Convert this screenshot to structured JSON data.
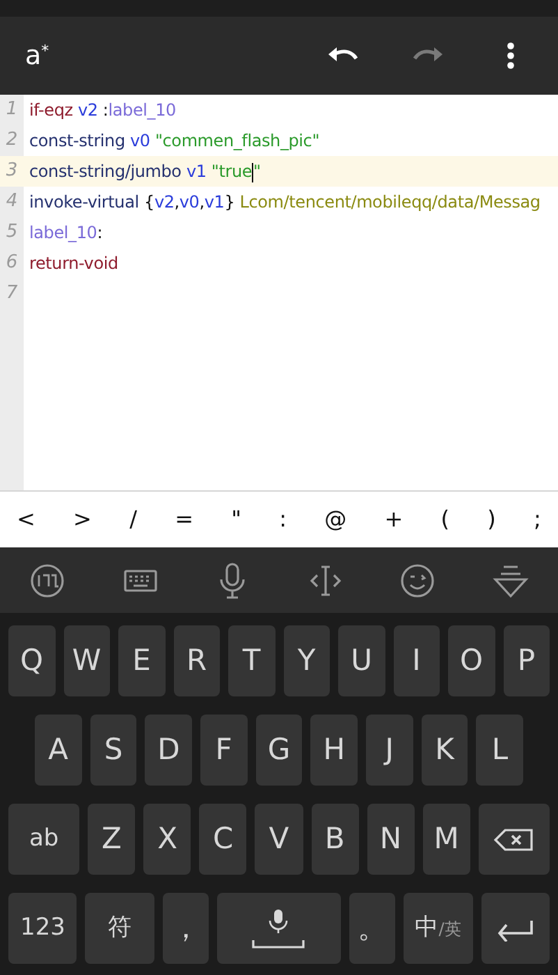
{
  "app_bar": {
    "title": "a$^{*}$",
    "actions": [
      {
        "kind": "undo",
        "disabled": false
      },
      {
        "kind": "redo",
        "disabled": true
      },
      {
        "kind": "menu",
        "disabled": false
      }
    ]
  },
  "editor": {
    "lines": [
      {
        "number": "1",
        "current": false,
        "tokens": [
          {
            "text": "if-eqz ",
            "kind": "keyword"
          },
          {
            "text": "v2",
            "kind": "register"
          },
          {
            "text": " :",
            "kind": "plain"
          },
          {
            "text": "label_10",
            "kind": "label"
          }
        ]
      },
      {
        "number": "2",
        "current": false,
        "tokens": [
          {
            "text": "const-string ",
            "kind": "op"
          },
          {
            "text": "v0",
            "kind": "register"
          },
          {
            "text": " \"commen_flash_pic\"",
            "kind": "string"
          }
        ]
      },
      {
        "number": "3",
        "current": true,
        "tokens": [
          {
            "text": "const-string/jumbo ",
            "kind": "op"
          },
          {
            "text": "v1",
            "kind": "register"
          },
          {
            "text": " \"true",
            "kind": "string"
          },
          {
            "kind": "cursor"
          },
          {
            "text": "\"",
            "kind": "string"
          }
        ]
      },
      {
        "number": "4",
        "current": false,
        "tokens": [
          {
            "text": "invoke-virtual",
            "kind": "op"
          },
          {
            "text": " {",
            "kind": "plain"
          },
          {
            "text": "v2",
            "kind": "register"
          },
          {
            "text": ",",
            "kind": "plain"
          },
          {
            "text": "v0",
            "kind": "register"
          },
          {
            "text": ",",
            "kind": "plain"
          },
          {
            "text": "v1",
            "kind": "register"
          },
          {
            "text": "} ",
            "kind": "plain"
          },
          {
            "text": "Lcom/tencent/mobileqq/data/Messag",
            "kind": "class"
          }
        ]
      },
      {
        "number": "5",
        "current": false,
        "tokens": [
          {
            "text": "label_10",
            "kind": "label"
          },
          {
            "text": ":",
            "kind": "plain"
          }
        ]
      },
      {
        "number": "6",
        "current": false,
        "tokens": [
          {
            "text": "return-void",
            "kind": "keyword"
          }
        ]
      },
      {
        "number": "7",
        "current": false
      }
    ]
  },
  "symbol_bar": [
    "<",
    ">",
    "/",
    "=",
    "\"",
    ":",
    "@",
    "+",
    "(",
    ")",
    ";"
  ],
  "keyboard_toolbar": [
    {
      "kind": "logo"
    },
    {
      "kind": "keyboard"
    },
    {
      "kind": "mic"
    },
    {
      "kind": "cursor"
    },
    {
      "kind": "emoji"
    },
    {
      "kind": "hide"
    }
  ],
  "keyboard_rows": [
    [
      {
        "label": "Q",
        "kind": "letter"
      },
      {
        "label": "W",
        "kind": "letter"
      },
      {
        "label": "E",
        "kind": "letter"
      },
      {
        "label": "R",
        "kind": "letter"
      },
      {
        "label": "T",
        "kind": "letter"
      },
      {
        "label": "Y",
        "kind": "letter"
      },
      {
        "label": "U",
        "kind": "letter"
      },
      {
        "label": "I",
        "kind": "letter"
      },
      {
        "label": "O",
        "kind": "letter"
      },
      {
        "label": "P",
        "kind": "letter"
      }
    ],
    [
      {
        "label": "A",
        "kind": "letter"
      },
      {
        "label": "S",
        "kind": "letter"
      },
      {
        "label": "D",
        "kind": "letter"
      },
      {
        "label": "F",
        "kind": "letter"
      },
      {
        "label": "G",
        "kind": "letter"
      },
      {
        "label": "H",
        "kind": "letter"
      },
      {
        "label": "J",
        "kind": "letter"
      },
      {
        "label": "K",
        "kind": "letter"
      },
      {
        "label": "L",
        "kind": "letter"
      }
    ],
    [
      {
        "label": "ab",
        "kind": "wide"
      },
      {
        "label": "Z",
        "kind": "letter"
      },
      {
        "label": "X",
        "kind": "letter"
      },
      {
        "label": "C",
        "kind": "letter"
      },
      {
        "label": "V",
        "kind": "letter"
      },
      {
        "label": "B",
        "kind": "letter"
      },
      {
        "label": "N",
        "kind": "letter"
      },
      {
        "label": "M",
        "kind": "letter"
      },
      {
        "kind": "backspace"
      }
    ],
    [
      {
        "label": "123",
        "kind": "wide"
      },
      {
        "label": "符",
        "kind": "wide"
      },
      {
        "label": "，",
        "kind": "letter"
      },
      {
        "kind": "space"
      },
      {
        "label": "。",
        "kind": "letter"
      },
      {
        "label": "中",
        "sub_label": "/英",
        "kind": "wide"
      },
      {
        "kind": "enter"
      }
    ]
  ]
}
